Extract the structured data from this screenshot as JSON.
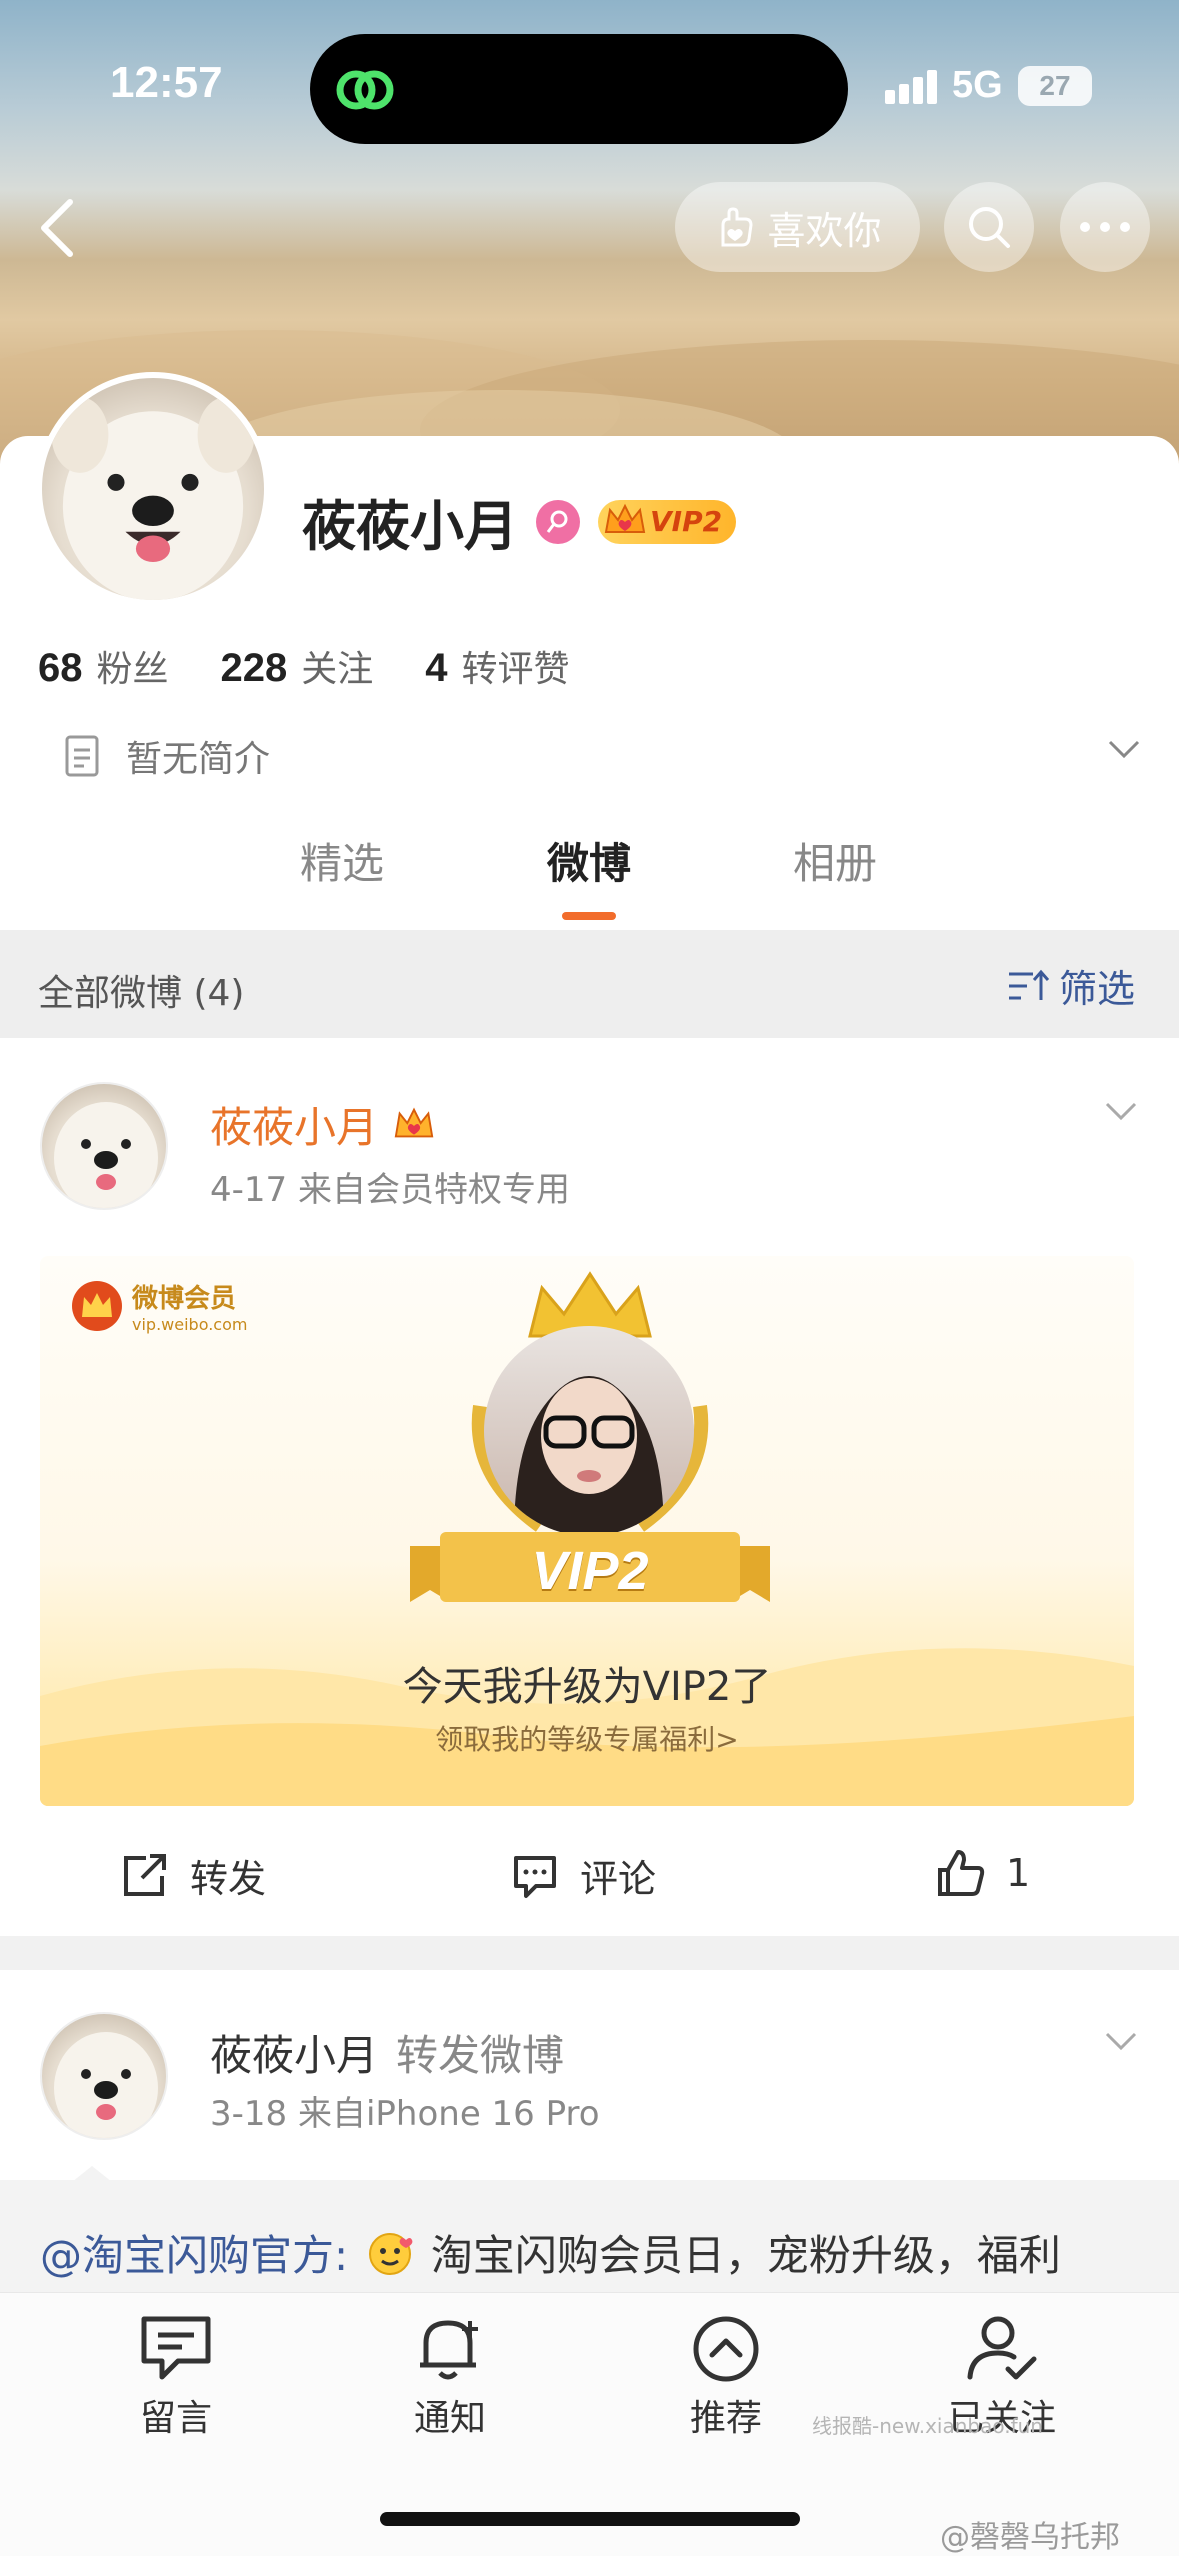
{
  "status_bar": {
    "time": "12:57",
    "network": "5G",
    "battery": "27"
  },
  "header": {
    "like_label": "喜欢你"
  },
  "profile": {
    "name": "莜莜小月",
    "vip_badge": "VIP2",
    "stats": [
      {
        "num": "68",
        "label": "粉丝"
      },
      {
        "num": "228",
        "label": "关注"
      },
      {
        "num": "4",
        "label": "转评赞"
      }
    ],
    "bio": "暂无简介"
  },
  "tabs": [
    {
      "label": "精选"
    },
    {
      "label": "微博"
    },
    {
      "label": "相册"
    }
  ],
  "filter": {
    "title": "全部微博 (4)",
    "button": "筛选"
  },
  "post1": {
    "name": "莜莜小月",
    "meta": "4-17  来自会员特权专用",
    "card": {
      "logo_text": "微博会员",
      "logo_sub": "vip.weibo.com",
      "ribbon": "VIP2",
      "title": "今天我升级为VIP2了",
      "subtitle": "领取我的等级专属福利>"
    },
    "actions": {
      "repost": "转发",
      "comment": "评论",
      "like_count": "1"
    }
  },
  "post2": {
    "name": "莜莜小月",
    "type": "转发微博",
    "meta": "3-18  来自iPhone 16 Pro",
    "mention": "@淘宝闪购官方:",
    "text": "淘宝闪购会员日，宠粉升级，福利"
  },
  "bottom_nav": [
    {
      "label": "留言",
      "icon": "message-icon"
    },
    {
      "label": "通知",
      "icon": "bell-icon"
    },
    {
      "label": "推荐",
      "icon": "recommend-icon"
    },
    {
      "label": "已关注",
      "icon": "followed-icon"
    }
  ],
  "watermarks": {
    "small": "线报酷-new.xianbao.fun",
    "large": "@磬磬乌托邦"
  },
  "colors": {
    "accent": "#f26c2b",
    "link": "#3b5998",
    "username_orange": "#e8742a"
  }
}
